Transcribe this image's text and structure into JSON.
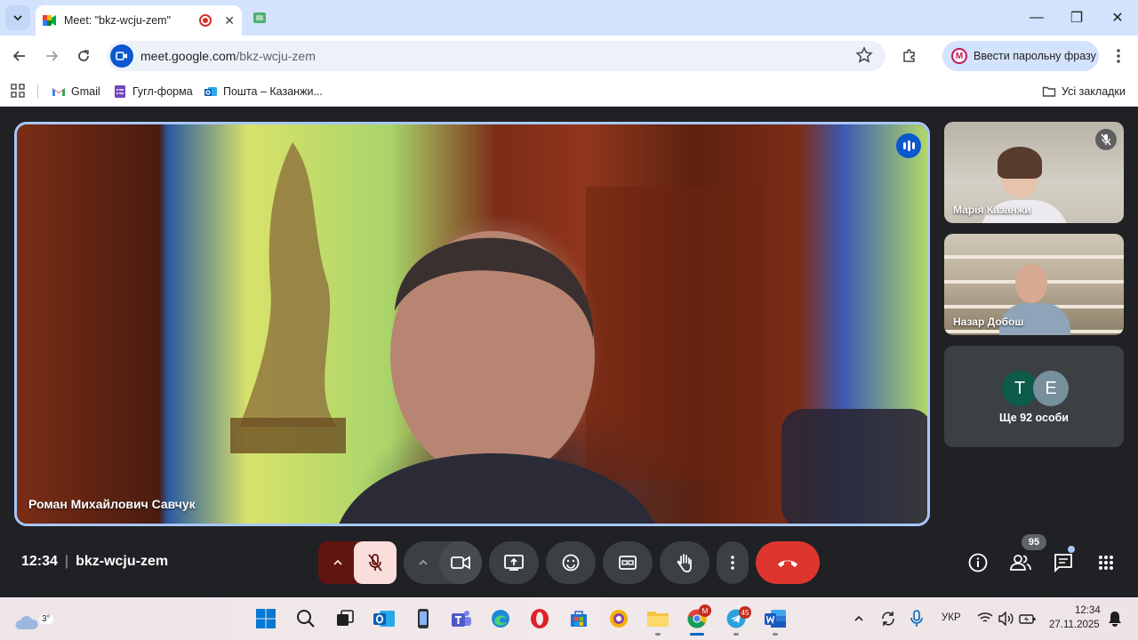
{
  "browser": {
    "tab": {
      "title": "Meet: \"bkz-wcju-zem\"",
      "close": "✕"
    },
    "window_controls": {
      "minimize": "—",
      "restore": "❐",
      "close": "✕"
    },
    "url_host": "meet.google.com",
    "url_path": "/bkz-wcju-zem",
    "profile": {
      "initial": "M",
      "label": "Ввести парольну фразу"
    },
    "bookmarks": [
      {
        "label": "Gmail"
      },
      {
        "label": "Гугл-форма"
      },
      {
        "label": "Пошта – Казанжи..."
      }
    ],
    "all_bookmarks": "Усі закладки"
  },
  "meet": {
    "main_speaker": "Роман Михайлович Савчук",
    "participants": [
      {
        "name": "Марія Казанжи",
        "muted": true
      },
      {
        "name": "Назар Добош"
      }
    ],
    "more": {
      "avatars": [
        {
          "letter": "Т",
          "color": "#0d5b4a"
        },
        {
          "letter": "Е",
          "color": "#78909c"
        }
      ],
      "label": "Ще 92 особи"
    },
    "time": "12:34",
    "meeting_code": "bkz-wcju-zem",
    "people_count": "95",
    "colors": {
      "accent": "#a8c7fa",
      "hangup": "#dc362e",
      "muted_bg": "#f9dedc"
    }
  },
  "taskbar": {
    "weather_temp": "3°",
    "outlook_badge": "",
    "chrome_badge": "M",
    "telegram_badge": "45",
    "language": "УКР",
    "clock_time": "12:34",
    "clock_date": "27.11.2025"
  }
}
